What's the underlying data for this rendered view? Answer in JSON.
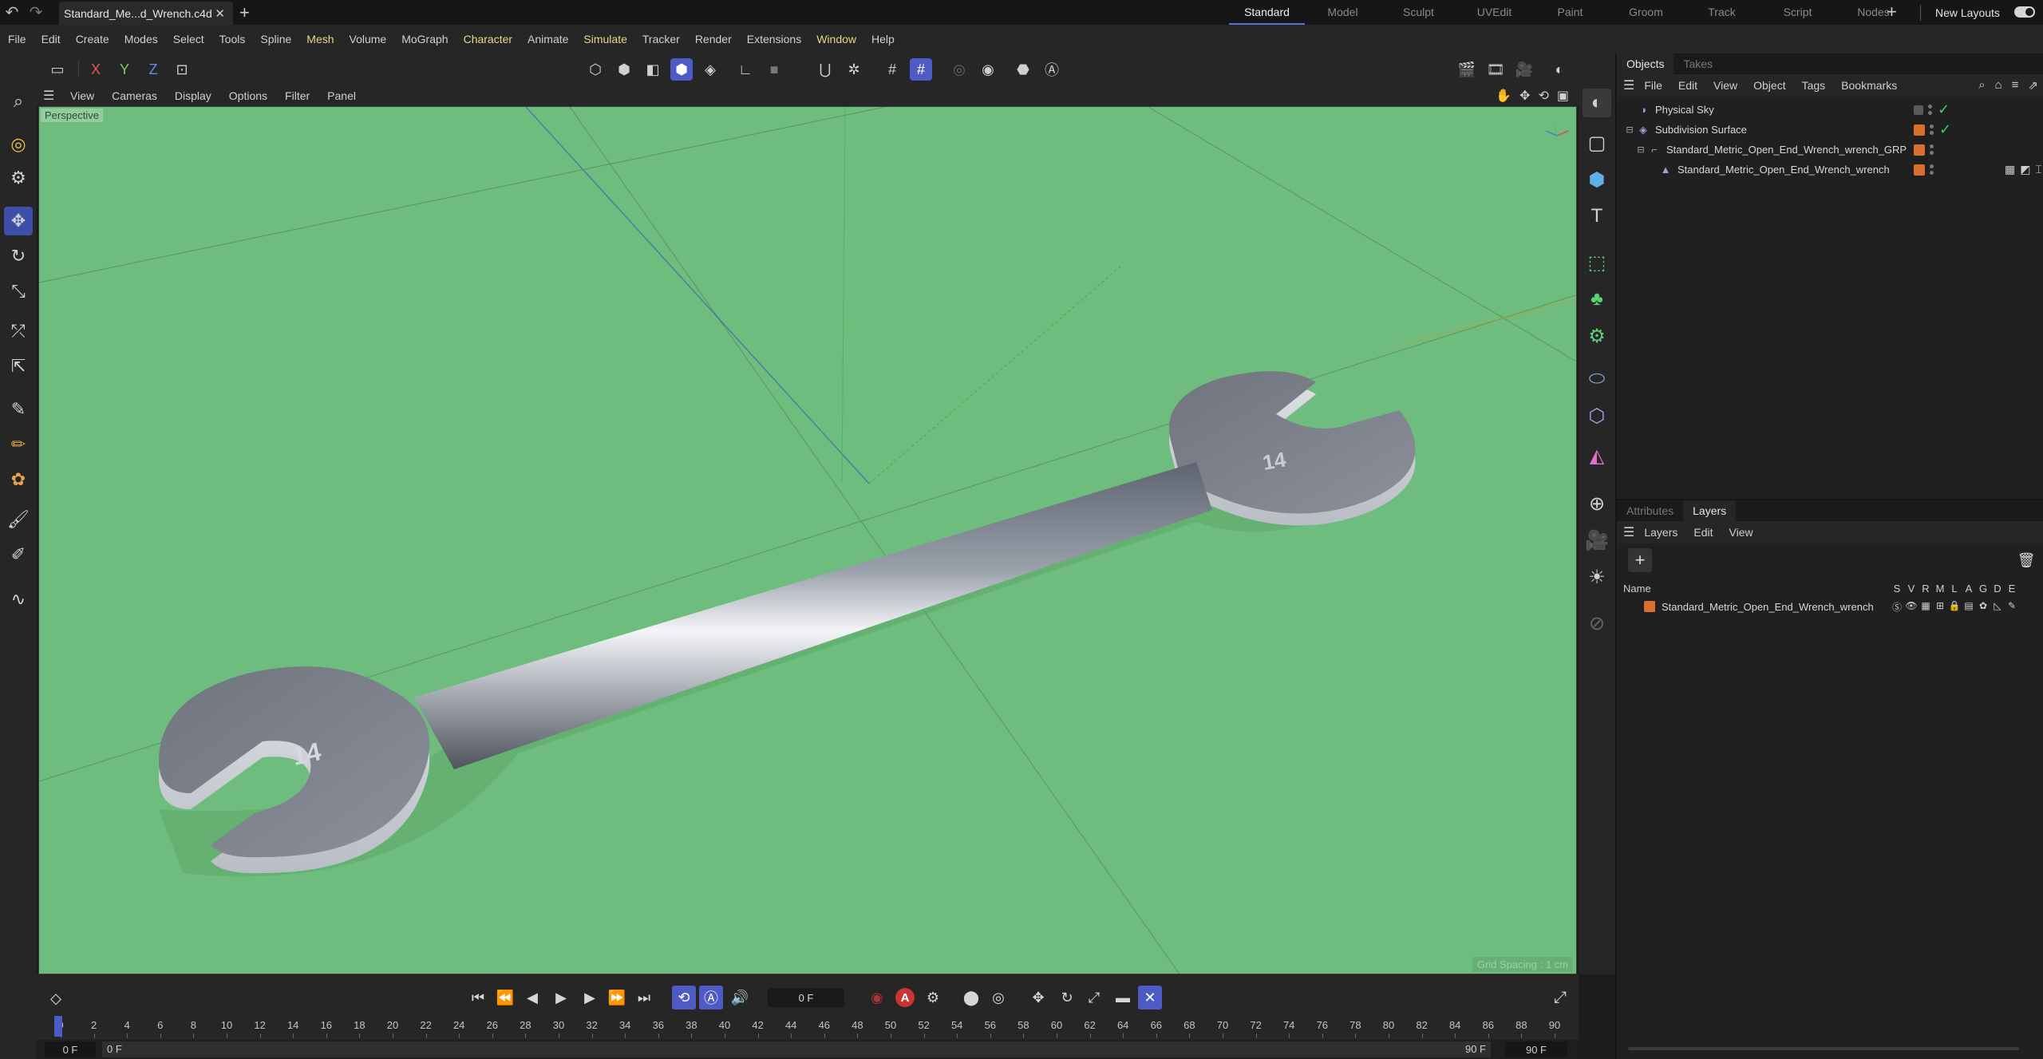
{
  "title_bar": {
    "document_tab": "Standard_Me...d_Wrench.c4d",
    "layouts": [
      "Standard",
      "Model",
      "Sculpt",
      "UVEdit",
      "Paint",
      "Groom",
      "Track",
      "Script",
      "Nodes"
    ],
    "active_layout": "Standard",
    "new_layouts": "New Layouts"
  },
  "menu": [
    "File",
    "Edit",
    "Create",
    "Modes",
    "Select",
    "Tools",
    "Spline",
    "Mesh",
    "Volume",
    "MoGraph",
    "Character",
    "Animate",
    "Simulate",
    "Tracker",
    "Render",
    "Extensions",
    "Window",
    "Help"
  ],
  "toolbar": {
    "axis_x": "X",
    "axis_y": "Y",
    "axis_z": "Z"
  },
  "viewport": {
    "menu": [
      "View",
      "Cameras",
      "Display",
      "Options",
      "Filter",
      "Panel"
    ],
    "camera_label": "Perspective",
    "grid_spacing": "Grid Spacing : 1 cm",
    "background_color": "#6fbd7e"
  },
  "objects_panel": {
    "tabs": [
      "Objects",
      "Takes"
    ],
    "active_tab": "Objects",
    "menu": [
      "File",
      "Edit",
      "View",
      "Object",
      "Tags",
      "Bookmarks"
    ],
    "objects": [
      {
        "name": "Physical Sky",
        "level": 0
      },
      {
        "name": "Subdivision Surface",
        "level": 0
      },
      {
        "name": "Standard_Metric_Open_End_Wrench_wrench_GRP",
        "level": 1
      },
      {
        "name": "Standard_Metric_Open_End_Wrench_wrench",
        "level": 2
      }
    ]
  },
  "layers_panel": {
    "tabs": [
      "Attributes",
      "Layers"
    ],
    "active_tab": "Layers",
    "menu": [
      "Layers",
      "Edit",
      "View"
    ],
    "name_header": "Name",
    "columns": [
      "S",
      "V",
      "R",
      "M",
      "L",
      "A",
      "G",
      "D",
      "E"
    ],
    "layers": [
      {
        "name": "Standard_Metric_Open_End_Wrench_wrench",
        "color": "#d9702e"
      }
    ]
  },
  "timeline": {
    "current_frame": "0 F",
    "ticks": [
      "0",
      "2",
      "4",
      "6",
      "8",
      "10",
      "12",
      "14",
      "16",
      "18",
      "20",
      "22",
      "24",
      "26",
      "28",
      "30",
      "32",
      "34",
      "36",
      "38",
      "40",
      "42",
      "44",
      "46",
      "48",
      "50",
      "52",
      "54",
      "56",
      "58",
      "60",
      "62",
      "64",
      "66",
      "68",
      "70",
      "72",
      "74",
      "76",
      "78",
      "80",
      "82",
      "84",
      "86",
      "88",
      "90"
    ],
    "range_start": "0 F",
    "range_start_inner": "0 F",
    "range_end_inner": "90 F",
    "range_end": "90 F"
  },
  "colors": {
    "accent": "#4f5bc4",
    "layer_orange": "#d9702e",
    "viewport_green": "#6fbd7e"
  }
}
